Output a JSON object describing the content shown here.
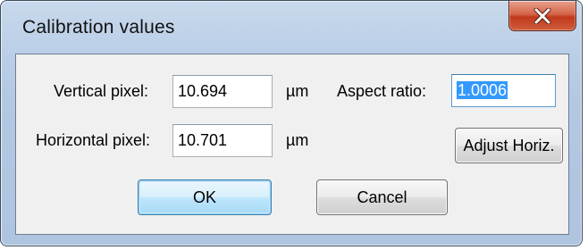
{
  "window": {
    "title": "Calibration values",
    "close_glyph": "X"
  },
  "fields": {
    "vertical_pixel": {
      "label": "Vertical pixel:",
      "value": "10.694",
      "unit": "µm"
    },
    "horizontal_pixel": {
      "label": "Horizontal pixel:",
      "value": "10.701",
      "unit": "µm"
    },
    "aspect_ratio": {
      "label": "Aspect ratio:",
      "value": "1.0006",
      "selected": true
    }
  },
  "buttons": {
    "adjust_horiz": "Adjust Horiz.",
    "ok": "OK",
    "cancel": "Cancel"
  },
  "colors": {
    "selection": "#3399ff",
    "close_button": "#c0391b",
    "default_button_border": "#3c7fb1"
  }
}
